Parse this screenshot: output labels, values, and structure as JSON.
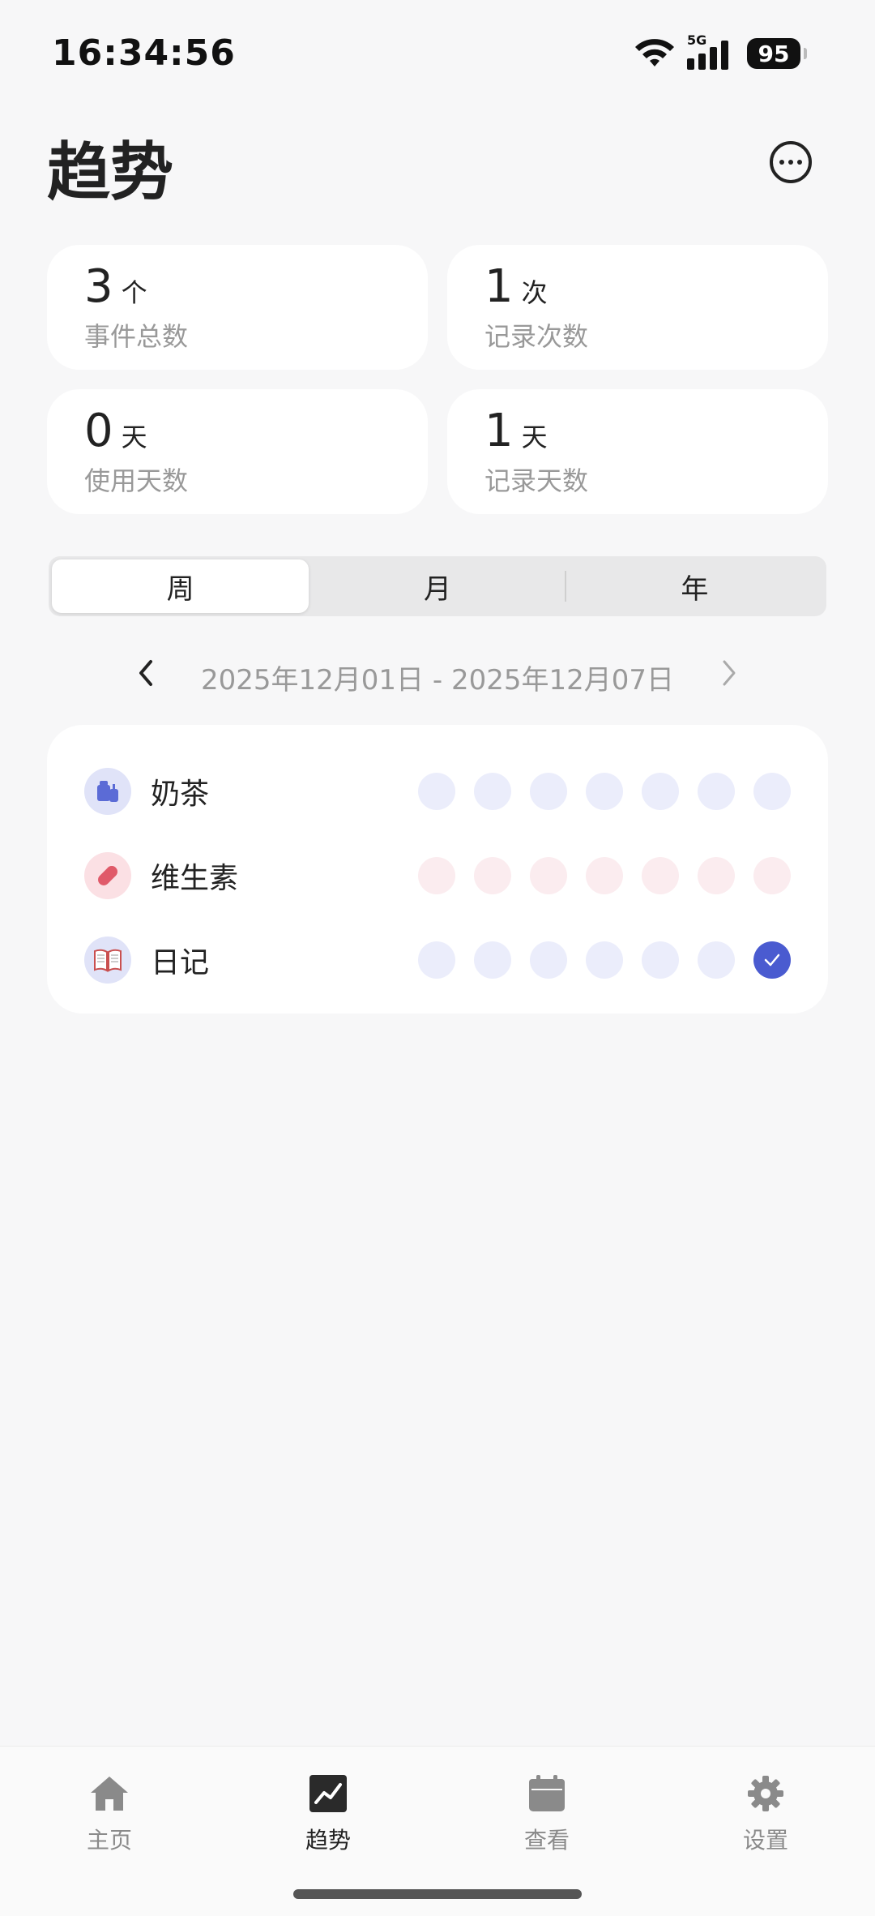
{
  "status": {
    "time": "16:34:56",
    "network": "5G",
    "battery": "95"
  },
  "header": {
    "title": "趋势"
  },
  "stats": [
    {
      "value": "3",
      "unit": "个",
      "label": "事件总数"
    },
    {
      "value": "1",
      "unit": "次",
      "label": "记录次数"
    },
    {
      "value": "0",
      "unit": "天",
      "label": "使用天数"
    },
    {
      "value": "1",
      "unit": "天",
      "label": "记录天数"
    }
  ],
  "segments": {
    "week": "周",
    "month": "月",
    "year": "年",
    "selected": "周"
  },
  "date_range": {
    "text": "2025年12月01日 - 2025年12月07日"
  },
  "habits": [
    {
      "name": "奶茶",
      "icon": "milk-tea-icon",
      "color": "#5b6bd6",
      "dot_color": "#ebedfb",
      "done": [
        false,
        false,
        false,
        false,
        false,
        false,
        false
      ]
    },
    {
      "name": "维生素",
      "icon": "pill-icon",
      "color": "#e05a6a",
      "dot_color": "#fbecef",
      "done": [
        false,
        false,
        false,
        false,
        false,
        false,
        false
      ]
    },
    {
      "name": "日记",
      "icon": "book-icon",
      "color": "#4a5bd0",
      "dot_color": "#ebedfb",
      "done": [
        false,
        false,
        false,
        false,
        false,
        false,
        true
      ]
    }
  ],
  "bottom_nav": [
    {
      "label": "主页",
      "icon": "home-icon",
      "active": false
    },
    {
      "label": "趋势",
      "icon": "trend-icon",
      "active": true
    },
    {
      "label": "查看",
      "icon": "calendar-icon",
      "active": false
    },
    {
      "label": "设置",
      "icon": "gear-icon",
      "active": false
    }
  ]
}
